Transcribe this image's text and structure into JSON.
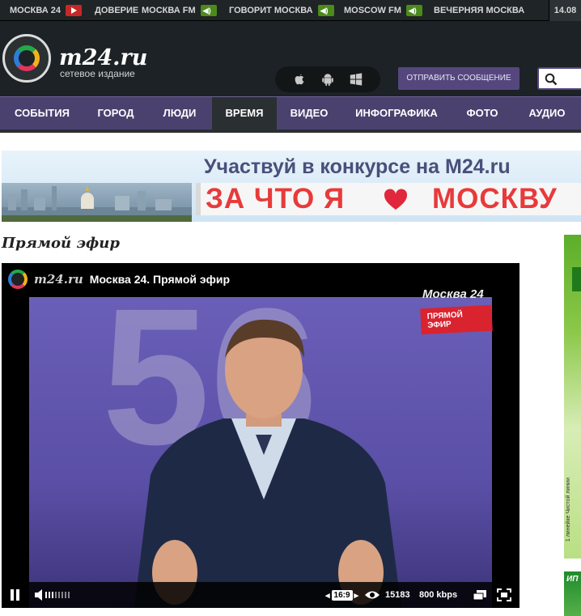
{
  "topbar": {
    "items": [
      {
        "label": "МОСКВА 24",
        "icon": "play-icon"
      },
      {
        "label": "ДОВЕРИЕ"
      },
      {
        "label": "МОСКВА FM",
        "icon": "audio-icon"
      },
      {
        "label": "ГОВОРИТ МОСКВА",
        "icon": "audio-icon"
      },
      {
        "label": "MOSCOW FM",
        "icon": "audio-icon"
      },
      {
        "label": "ВЕЧЕРНЯЯ МОСКВА"
      }
    ],
    "date": "14.08"
  },
  "header": {
    "logo_text": "m24.ru",
    "logo_sub": "сетевое издание",
    "send_button": "ОТПРАВИТЬ СООБЩЕНИЕ",
    "platform_icons": [
      "apple-icon",
      "android-icon",
      "windows-icon"
    ]
  },
  "nav": {
    "items": [
      "СОБЫТИЯ",
      "ГОРОД",
      "ЛЮДИ",
      "ВРЕМЯ",
      "ВИДЕО",
      "ИНФОГРАФИКА",
      "ФОТО",
      "АУДИО"
    ],
    "active": "ВРЕМЯ"
  },
  "banner": {
    "line1": "Участвуй в конкурсе на M24.ru",
    "line2a": "ЗА ЧТО Я",
    "line2b": "МОСКВУ"
  },
  "section": {
    "title": "Прямой эфир"
  },
  "player": {
    "brand": "m24.ru",
    "title": "Москва 24. Прямой эфир",
    "channel_badge": "Москва 24",
    "live_badge": "ПРЯМОЙ ЭФИР",
    "bg_number": "56",
    "aspect": "16:9",
    "viewers": "15183",
    "bitrate": "800 kbps",
    "volume_level": 0.4
  },
  "ad": {
    "vertical_text": "1 линейке Чистой линии",
    "bottom_text": "ИП"
  },
  "colors": {
    "nav": "#4b416f",
    "header": "#1c2225",
    "accent_red": "#e83a3a"
  }
}
